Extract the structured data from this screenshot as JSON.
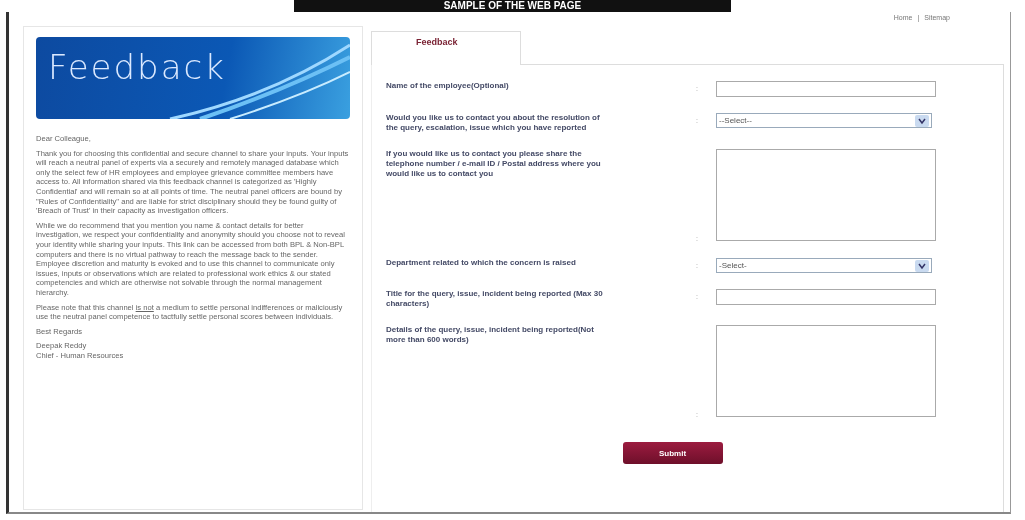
{
  "banner": {
    "title": "SAMPLE OF THE WEB PAGE"
  },
  "top_links": [
    "Home",
    "Sitemap"
  ],
  "top_link_separator": "|",
  "left_panel": {
    "header_title": "Feedback",
    "greeting": "Dear Colleague,",
    "paragraphs": [
      "Thank you for choosing this confidential and secure channel to share your inputs. Your inputs will reach a neutral panel of experts via a securely and remotely managed database which only the select few of HR employees and employee grievance committee members have access to. All information shared via this feedback channel is categorized as 'Highly Confidential' and will remain so at all points of time. The neutral panel officers are bound by \"Rules of Confidentiality\" and are liable for strict disciplinary should they be found guilty of 'Breach of Trust' in their capacity as investigation officers.",
      "While we do recommend that you mention you name & contact details for better investigation, we respect your confidentiality and anonymity should you choose not to reveal your identity while sharing your inputs. This link can be accessed from both BPL & Non-BPL computers and there is no virtual pathway to reach the message back to the sender. Employee discretion and maturity is evoked and to use this channel to communicate only issues, inputs or observations which are related to professional work ethics & our stated competencies and which are otherwise not solvable through the normal management hierarchy."
    ],
    "note": {
      "before": "Please note that this channel ",
      "underlined": "is not",
      "after": " a medium to settle personal indifferences or maliciously use the neutral panel competence to tactfully settle personal scores between individuals."
    },
    "closing": "Best Regards",
    "signature": [
      "Deepak Reddy",
      "Chief - Human Resources"
    ]
  },
  "tabs": [
    {
      "label": "Feedback",
      "selected": true
    }
  ],
  "form": {
    "fields": [
      {
        "kind": "text",
        "label": "Name of the employee(Optional)",
        "separator": ":"
      },
      {
        "kind": "select",
        "label": "Would you like us to contact you about the resolution of the query, escalation, issue which you have reported",
        "separator": ":",
        "value": "--Select--"
      },
      {
        "kind": "textarea",
        "label": "If you would like us to contact you please share the telephone number / e-mail ID / Postal address where you would like us to contact you",
        "separator": ":"
      },
      {
        "kind": "select",
        "label": "Department related to which the concern is raised",
        "separator": ":",
        "value": "-Select-"
      },
      {
        "kind": "text",
        "label": "Title for the query, issue, incident being reported (Max 30 characters)",
        "separator": ":"
      },
      {
        "kind": "textarea",
        "label": "Details of the query, issue, incident being reported(Not more than 600 words)",
        "separator": ":"
      }
    ],
    "submit": "Submit"
  }
}
